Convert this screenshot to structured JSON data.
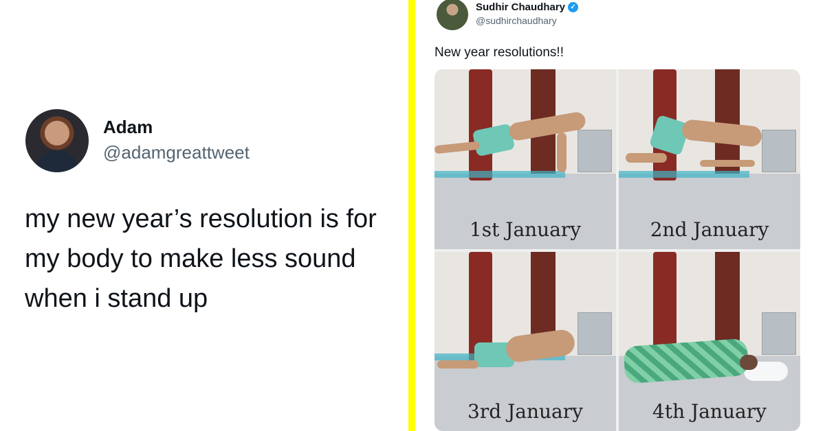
{
  "left_tweet": {
    "name": "Adam",
    "handle": "@adamgreattweet",
    "text": "my new year’s resolution is for my body to make less sound when i stand up"
  },
  "right_tweet": {
    "name": "Sudhir Chaudhary",
    "handle": "@sudhirchaudhary",
    "verified_icon": "verified-badge-icon",
    "text": "New year resolutions!!",
    "panels": [
      {
        "caption": "1st January"
      },
      {
        "caption": "2nd January"
      },
      {
        "caption": "3rd January"
      },
      {
        "caption": "4th January"
      }
    ]
  },
  "colors": {
    "divider": "#ffff00",
    "handle": "#536471",
    "verified": "#1d9bf0"
  }
}
